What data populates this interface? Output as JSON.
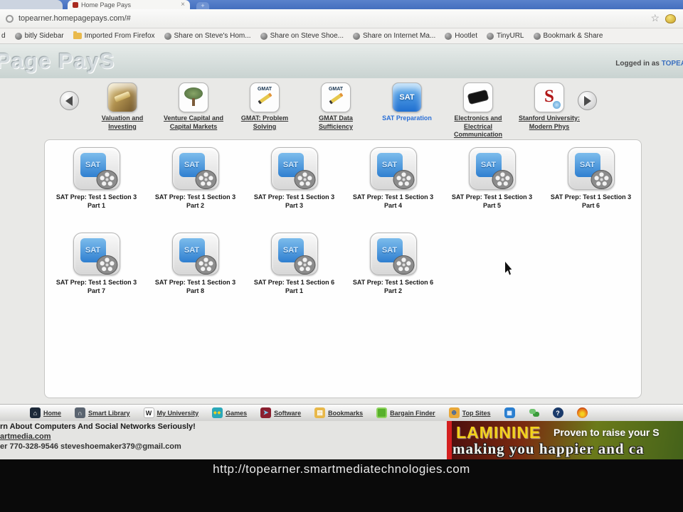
{
  "browser": {
    "tab": {
      "title": "Home Page Pays"
    },
    "address": {
      "url": "topearner.homepagepays.com/#"
    },
    "bookmarks": [
      {
        "label": "d"
      },
      {
        "label": "bitly Sidebar"
      },
      {
        "label": "Imported From Firefox"
      },
      {
        "label": "Share on Steve's Hom..."
      },
      {
        "label": "Share on Steve Shoe..."
      },
      {
        "label": "Share on Internet Ma..."
      },
      {
        "label": "Hootlet"
      },
      {
        "label": "TinyURL"
      },
      {
        "label": "Bookmark & Share"
      }
    ]
  },
  "header": {
    "brand": "Page PayS",
    "logged_in_prefix": "Logged in as",
    "username": "TOPEA"
  },
  "carousel": {
    "items": [
      {
        "label": "Valuation and Investing"
      },
      {
        "label": "Venture Capital and Capital Markets"
      },
      {
        "label": "GMAT: Problem Solving"
      },
      {
        "label": "GMAT Data Sufficiency"
      },
      {
        "label": "SAT Preparation",
        "selected": true
      },
      {
        "label": "Electronics and Electrical Communication"
      },
      {
        "label": "Stanford University: Modern Phys"
      }
    ]
  },
  "grid": {
    "items": [
      {
        "row": 1,
        "title": "SAT Prep: Test 1 Section 3",
        "part": "Part 1"
      },
      {
        "row": 1,
        "title": "SAT Prep: Test 1 Section 3",
        "part": "Part 2"
      },
      {
        "row": 1,
        "title": "SAT Prep: Test 1 Section 3",
        "part": "Part 3"
      },
      {
        "row": 1,
        "title": "SAT Prep: Test 1 Section 3",
        "part": "Part 4"
      },
      {
        "row": 1,
        "title": "SAT Prep: Test 1 Section 3",
        "part": "Part 5"
      },
      {
        "row": 1,
        "title": "SAT Prep: Test 1 Section 3",
        "part": "Part 6"
      },
      {
        "row": 2,
        "title": "SAT Prep: Test 1 Section 3",
        "part": "Part 7"
      },
      {
        "row": 2,
        "title": "SAT Prep: Test 1 Section 3",
        "part": "Part 8"
      },
      {
        "row": 2,
        "title": "SAT Prep: Test 1 Section 6",
        "part": "Part 1"
      },
      {
        "row": 2,
        "title": "SAT Prep: Test 1 Section 6",
        "part": "Part 2"
      }
    ]
  },
  "toolbar": {
    "items": [
      {
        "label": "Home"
      },
      {
        "label": "Smart Library"
      },
      {
        "label": "My University"
      },
      {
        "label": "Games"
      },
      {
        "label": "Software"
      },
      {
        "label": "Bookmarks"
      },
      {
        "label": "Bargain Finder"
      },
      {
        "label": "Top Sites"
      }
    ]
  },
  "footer": {
    "line1": "rn About Computers And Social Networks Seriously!",
    "line2": "artmedia.com",
    "line3": "er 770-328-9546 steveshoemaker379@gmail.com"
  },
  "ad": {
    "brand": "LAMININE",
    "line1": "Proven to raise your S",
    "line2": "making you happier and ca"
  },
  "caption": "http://topearner.smartmediatechnologies.com",
  "icons": {
    "close": "×",
    "star": "☆",
    "new_tab": "+",
    "home": "⌂",
    "library": "∩",
    "university": "W",
    "games": "◆◆",
    "software": "➤",
    "bookmarks": "▤",
    "bargain": "",
    "topsites": "⊕",
    "tv": "▦",
    "help": "?",
    "gmat_text": "GMAT",
    "sat_text": "SAT",
    "stanford_letter": "S"
  }
}
